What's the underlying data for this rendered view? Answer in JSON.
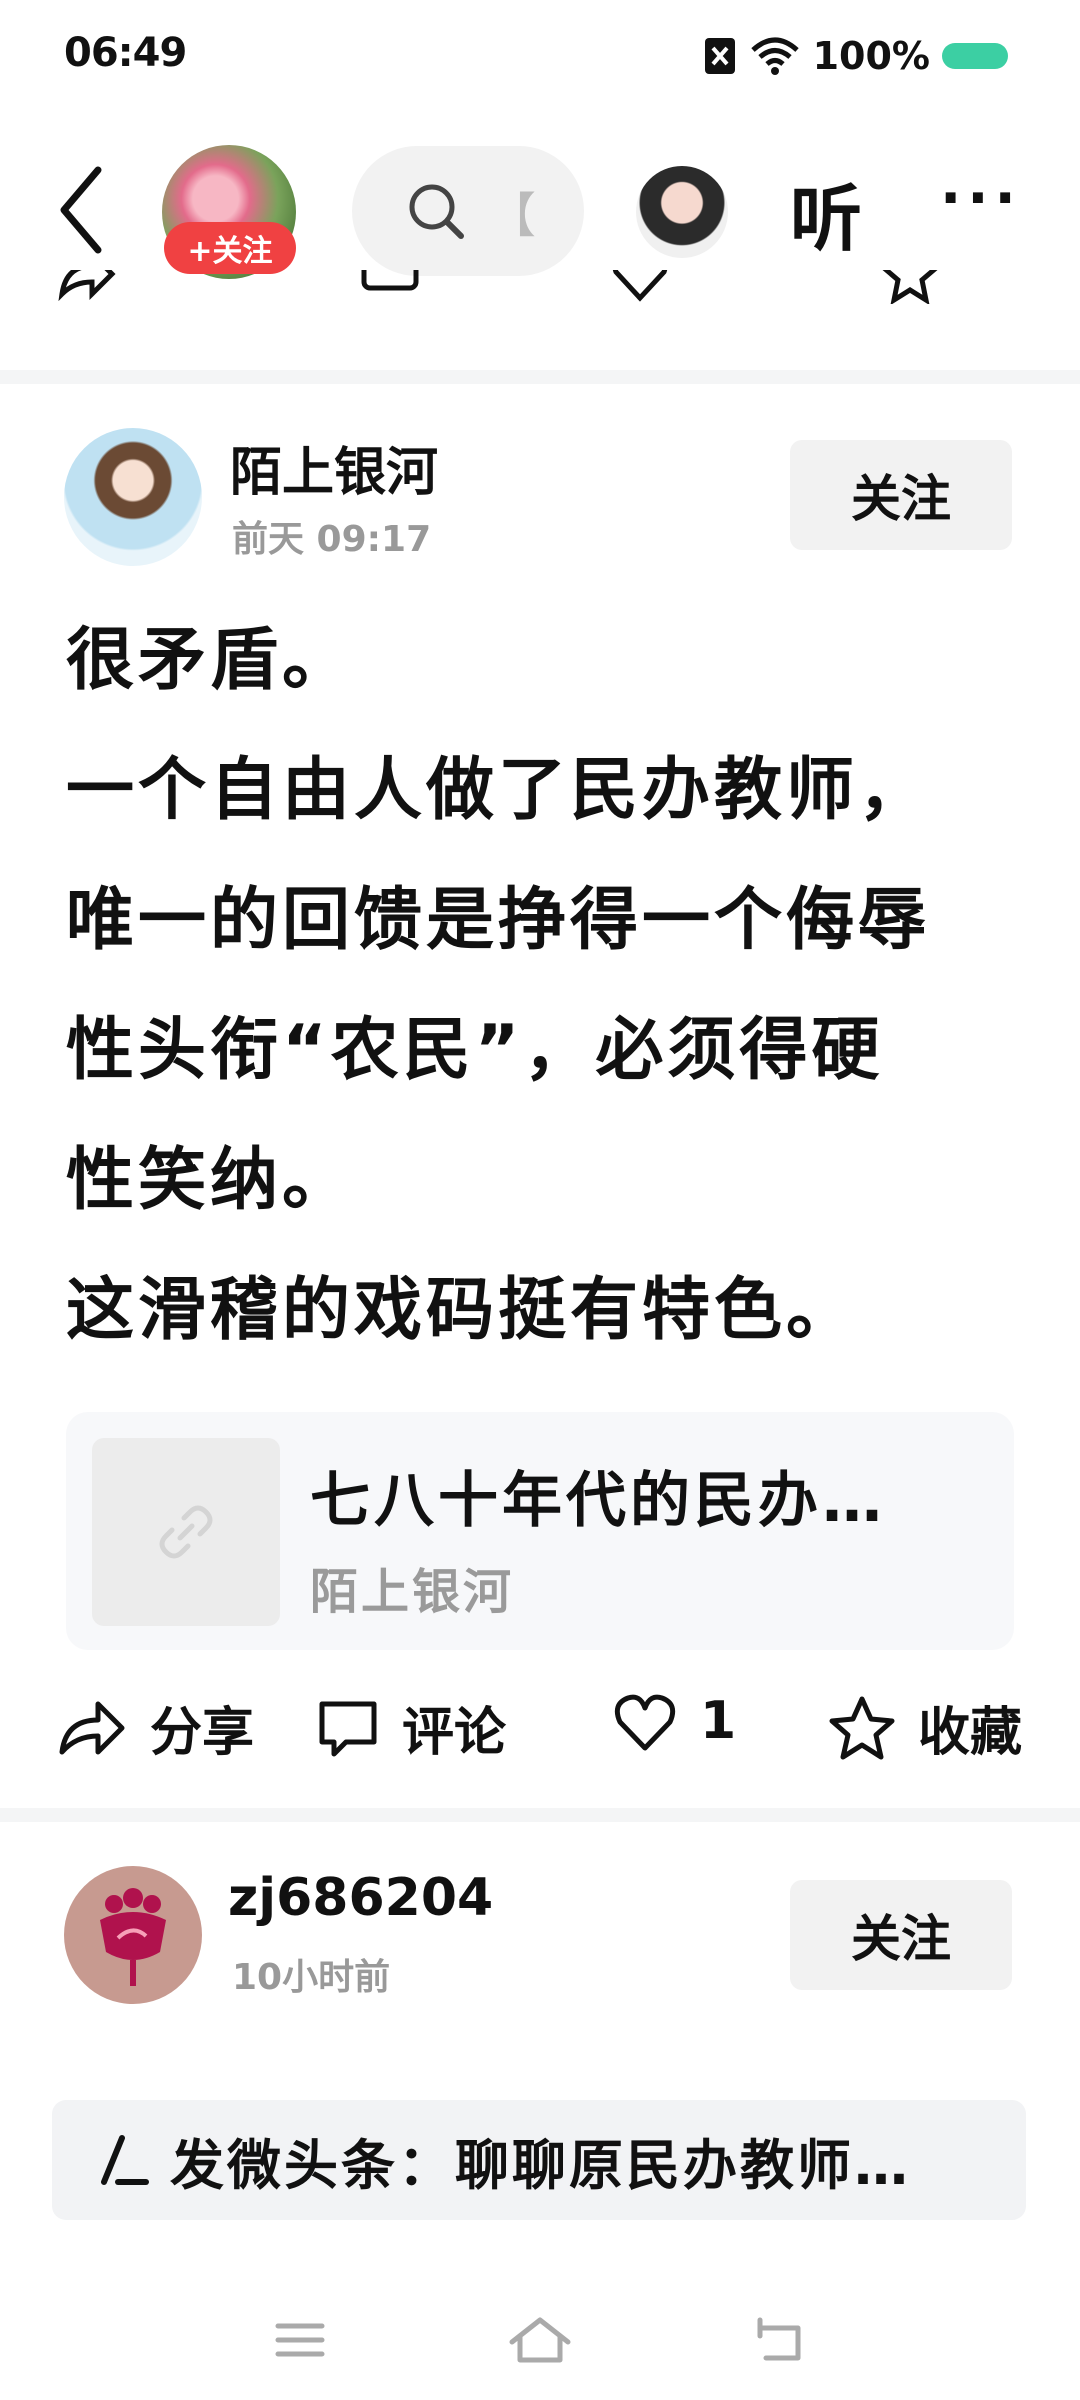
{
  "status_bar": {
    "time": "06:49",
    "battery": "100%"
  },
  "top_nav": {
    "follow_label": "+关注",
    "search_hint": "【",
    "listen_label": "听",
    "more_label": "···"
  },
  "post1": {
    "author": "陌上银河",
    "time": "前天   09:17",
    "follow_label": "关注",
    "lines": [
      "很矛盾。",
      "一个自由人做了民办教师，",
      "唯一的回馈是挣得一个侮辱",
      "性头衔“农民”，必须得硬",
      "性笑纳。",
      "这滑稽的戏码挺有特色。"
    ],
    "link_card": {
      "title": "七八十年代的民办…",
      "author": "陌上银河"
    },
    "actions": {
      "share": "分享",
      "comment": "评论",
      "likes": "1",
      "favorite": "收藏"
    }
  },
  "post2": {
    "author": "zj686204",
    "time": "10小时前",
    "follow_label": "关注"
  },
  "compose": {
    "text": "发微头条：聊聊原民办教师…"
  },
  "colors": {
    "accent_red": "#f04142",
    "battery_green": "#3ccfa3"
  }
}
